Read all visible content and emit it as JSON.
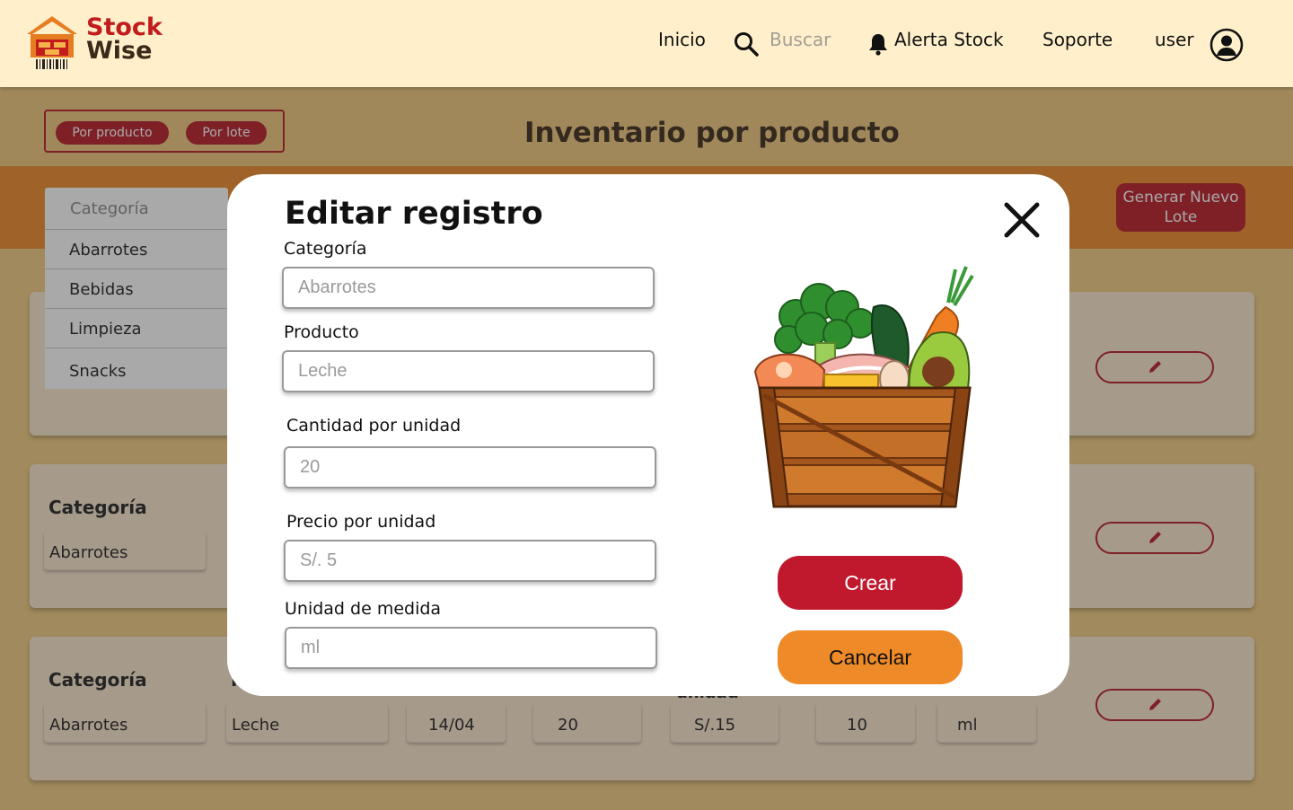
{
  "header": {
    "brand_line1": "Stock",
    "brand_line2": "Wise",
    "nav_home": "Inicio",
    "search_placeholder": "Buscar",
    "nav_alert": "Alerta Stock",
    "nav_support": "Soporte",
    "user_label": "user"
  },
  "view_toggle": {
    "by_product": "Por producto",
    "by_batch": "Por lote"
  },
  "page_title": "Inventario por producto",
  "generate_button": "Generar Nuevo Lote",
  "category_dropdown": {
    "placeholder": "Categoría",
    "options": [
      "Abarrotes",
      "Bebidas",
      "Limpieza",
      "Snacks"
    ]
  },
  "cards": [
    {
      "category_label": "Categoría",
      "category_value": "Abarrotes"
    },
    {
      "category_label": "Categoría",
      "category_value": "Abarrotes",
      "product": "Leche",
      "date": "14/04",
      "quantity": "20",
      "price": "S/.15",
      "stock": "10",
      "unit": "ml",
      "partial_label_a": "P",
      "partial_label_b": "unidad"
    }
  ],
  "modal": {
    "title": "Editar registro",
    "fields": [
      {
        "label": "Categoría",
        "placeholder": "Abarrotes"
      },
      {
        "label": "Producto",
        "placeholder": "Leche"
      },
      {
        "label": "Cantidad por unidad",
        "placeholder": "20"
      },
      {
        "label": "Precio por unidad",
        "placeholder": "S/. 5"
      },
      {
        "label": "Unidad de medida",
        "placeholder": "ml"
      }
    ],
    "create_button": "Crear",
    "cancel_button": "Cancelar"
  },
  "colors": {
    "brand_red": "#c0192e",
    "accent_orange": "#ef8a28",
    "header_bg": "#ffefcb"
  }
}
